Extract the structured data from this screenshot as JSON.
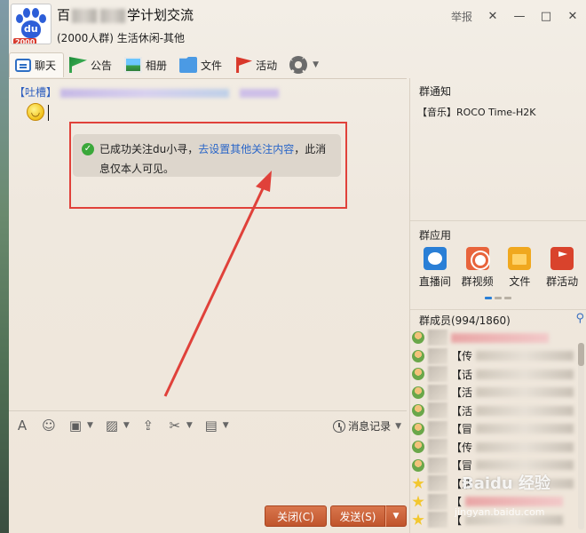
{
  "window": {
    "group_name_prefix": "百",
    "group_name_suffix": "学计划交流",
    "group_meta": "(2000人群) 生活休闲-其他",
    "avatar_badge": "2000",
    "avatar_logo_text": "du",
    "report_label": "举报"
  },
  "tabs": [
    {
      "label": "聊天",
      "icon": "chat-bubble-icon",
      "active": true
    },
    {
      "label": "公告",
      "icon": "flag-icon"
    },
    {
      "label": "相册",
      "icon": "photo-icon"
    },
    {
      "label": "文件",
      "icon": "folder-icon"
    },
    {
      "label": "活动",
      "icon": "red-flag-icon"
    }
  ],
  "chat": {
    "sender_tag": "【吐槽】",
    "notice_text_1": "已成功关注du小寻，",
    "notice_link": "去设置其他关注内容",
    "notice_text_2": "，此消息仅本人可见。"
  },
  "input_toolbar": {
    "history_label": "消息记录"
  },
  "buttons": {
    "close_label": "关闭(C)",
    "send_label": "发送(S)"
  },
  "right_panel": {
    "notice_title": "群通知",
    "notice_item": "【音乐】ROCO Time-H2K",
    "apps_title": "群应用",
    "apps": [
      {
        "label": "直播间",
        "icon": "live-room-icon"
      },
      {
        "label": "群视频",
        "icon": "group-video-icon"
      },
      {
        "label": "文件",
        "icon": "file-icon"
      },
      {
        "label": "群活动",
        "icon": "group-event-icon"
      }
    ],
    "members_title": "群成员(994/1860)",
    "members": [
      {
        "prefix": ""
      },
      {
        "prefix": "【传"
      },
      {
        "prefix": "【话"
      },
      {
        "prefix": "【活"
      },
      {
        "prefix": "【活"
      },
      {
        "prefix": "【冒"
      },
      {
        "prefix": "【传"
      },
      {
        "prefix": "【冒"
      },
      {
        "prefix": "【活"
      },
      {
        "prefix": "【"
      },
      {
        "prefix": "【"
      }
    ]
  },
  "watermark": {
    "text": "Baidu 经验",
    "sub": "jingyan.baidu.com"
  },
  "colors": {
    "accent_orange": "#c9603a",
    "highlight_red": "#e0413a",
    "link_blue": "#2a66c8"
  }
}
